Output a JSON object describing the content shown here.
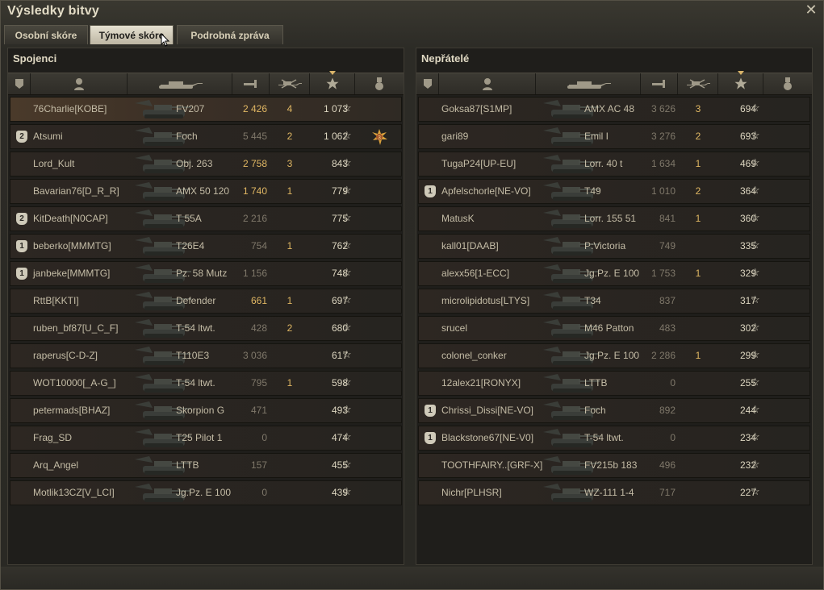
{
  "window": {
    "title": "Výsledky bitvy"
  },
  "tabs": [
    "Osobní skóre",
    "Týmové skóre",
    "Podrobná zpráva"
  ],
  "active_tab": 1,
  "left_team": {
    "title": "Spojenci",
    "players": [
      {
        "badge": "",
        "name": "76Charlie[KOBE]",
        "tank": "FV207",
        "dmg": "2 426",
        "dmg_hi": true,
        "frags": "4",
        "xp": "1 073",
        "me": true,
        "medal": false
      },
      {
        "badge": "2",
        "name": "Atsumi",
        "tank": "Foch",
        "dmg": "5 445",
        "dmg_hi": false,
        "frags": "2",
        "xp": "1 062",
        "me": false,
        "medal": true
      },
      {
        "badge": "",
        "name": "Lord_Kult",
        "tank": "Obj. 263",
        "dmg": "2 758",
        "dmg_hi": true,
        "frags": "3",
        "xp": "843",
        "me": false,
        "medal": false
      },
      {
        "badge": "",
        "name": "Bavarian76[D_R_R]",
        "tank": "AMX 50 120",
        "dmg": "1 740",
        "dmg_hi": true,
        "frags": "1",
        "xp": "779",
        "me": false,
        "medal": false
      },
      {
        "badge": "2",
        "name": "KitDeath[N0CAP]",
        "tank": "T 55A",
        "dmg": "2 216",
        "dmg_hi": false,
        "frags": "",
        "xp": "775",
        "me": false,
        "medal": false
      },
      {
        "badge": "1",
        "name": "beberko[MMMTG]",
        "tank": "T26E4",
        "dmg": "754",
        "dmg_hi": false,
        "frags": "1",
        "xp": "762",
        "me": false,
        "medal": false
      },
      {
        "badge": "1",
        "name": "janbeke[MMMTG]",
        "tank": "Pz. 58 Mutz",
        "dmg": "1 156",
        "dmg_hi": false,
        "frags": "",
        "xp": "748",
        "me": false,
        "medal": false
      },
      {
        "badge": "",
        "name": "RttB[KKTI]",
        "tank": "Defender",
        "dmg": "661",
        "dmg_hi": true,
        "frags": "1",
        "xp": "697",
        "me": false,
        "medal": false
      },
      {
        "badge": "",
        "name": "ruben_bf87[U_C_F]",
        "tank": "T-54 ltwt.",
        "dmg": "428",
        "dmg_hi": false,
        "frags": "2",
        "xp": "680",
        "me": false,
        "medal": false
      },
      {
        "badge": "",
        "name": "raperus[C-D-Z]",
        "tank": "T110E3",
        "dmg": "3 036",
        "dmg_hi": false,
        "frags": "",
        "xp": "617",
        "me": false,
        "medal": false
      },
      {
        "badge": "",
        "name": "WOT10000[_A-G_]",
        "tank": "T-54 ltwt.",
        "dmg": "795",
        "dmg_hi": false,
        "frags": "1",
        "xp": "598",
        "me": false,
        "medal": false
      },
      {
        "badge": "",
        "name": "petermads[BHAZ]",
        "tank": "Skorpion G",
        "dmg": "471",
        "dmg_hi": false,
        "frags": "",
        "xp": "493",
        "me": false,
        "medal": false
      },
      {
        "badge": "",
        "name": "Frag_SD",
        "tank": "T25 Pilot 1",
        "dmg": "0",
        "dmg_hi": false,
        "frags": "",
        "xp": "474",
        "me": false,
        "medal": false
      },
      {
        "badge": "",
        "name": "Arq_Angel",
        "tank": "LTTB",
        "dmg": "157",
        "dmg_hi": false,
        "frags": "",
        "xp": "455",
        "me": false,
        "medal": false
      },
      {
        "badge": "",
        "name": "Motlik13CZ[V_LCI]",
        "tank": "Jg.Pz. E 100",
        "dmg": "0",
        "dmg_hi": false,
        "frags": "",
        "xp": "439",
        "me": false,
        "medal": false
      }
    ]
  },
  "right_team": {
    "title": "Nepřátelé",
    "players": [
      {
        "badge": "",
        "name": "Goksa87[S1MP]",
        "tank": "AMX AC 48",
        "dmg": "3 626",
        "dmg_hi": false,
        "frags": "3",
        "xp": "694",
        "me": false,
        "medal": false
      },
      {
        "badge": "",
        "name": "gari89",
        "tank": "Emil I",
        "dmg": "3 276",
        "dmg_hi": false,
        "frags": "2",
        "xp": "693",
        "me": false,
        "medal": false
      },
      {
        "badge": "",
        "name": "TugaP24[UP-EU]",
        "tank": "Lorr. 40 t",
        "dmg": "1 634",
        "dmg_hi": false,
        "frags": "1",
        "xp": "469",
        "me": false,
        "medal": false
      },
      {
        "badge": "1",
        "name": "Apfelschorle[NE-VO]",
        "tank": "T49",
        "dmg": "1 010",
        "dmg_hi": false,
        "frags": "2",
        "xp": "364",
        "me": false,
        "medal": false
      },
      {
        "badge": "",
        "name": "MatusK",
        "tank": "Lorr. 155 51",
        "dmg": "841",
        "dmg_hi": false,
        "frags": "1",
        "xp": "360",
        "me": false,
        "medal": false
      },
      {
        "badge": "",
        "name": "kall01[DAAB]",
        "tank": "P:Victoria",
        "dmg": "749",
        "dmg_hi": false,
        "frags": "",
        "xp": "335",
        "me": false,
        "medal": false
      },
      {
        "badge": "",
        "name": "alexx56[1-ECC]",
        "tank": "Jg.Pz. E 100",
        "dmg": "1 753",
        "dmg_hi": false,
        "frags": "1",
        "xp": "329",
        "me": false,
        "medal": false
      },
      {
        "badge": "",
        "name": "microlipidotus[LTYS]",
        "tank": "T34",
        "dmg": "837",
        "dmg_hi": false,
        "frags": "",
        "xp": "317",
        "me": false,
        "medal": false
      },
      {
        "badge": "",
        "name": "srucel",
        "tank": "M46 Patton",
        "dmg": "483",
        "dmg_hi": false,
        "frags": "",
        "xp": "302",
        "me": false,
        "medal": false
      },
      {
        "badge": "",
        "name": "colonel_conker",
        "tank": "Jg.Pz. E 100",
        "dmg": "2 286",
        "dmg_hi": false,
        "frags": "1",
        "xp": "299",
        "me": false,
        "medal": false
      },
      {
        "badge": "",
        "name": "12alex21[RONYX]",
        "tank": "LTTB",
        "dmg": "0",
        "dmg_hi": false,
        "frags": "",
        "xp": "255",
        "me": false,
        "medal": false
      },
      {
        "badge": "1",
        "name": "Chrissi_Dissi[NE-VO]",
        "tank": "Foch",
        "dmg": "892",
        "dmg_hi": false,
        "frags": "",
        "xp": "244",
        "me": false,
        "medal": false
      },
      {
        "badge": "1",
        "name": "Blackstone67[NE-V0]",
        "tank": "T-54 ltwt.",
        "dmg": "0",
        "dmg_hi": false,
        "frags": "",
        "xp": "234",
        "me": false,
        "medal": false
      },
      {
        "badge": "",
        "name": "TOOTHFAIRY..[GRF-X]",
        "tank": "FV215b 183",
        "dmg": "496",
        "dmg_hi": false,
        "frags": "",
        "xp": "232",
        "me": false,
        "medal": false
      },
      {
        "badge": "",
        "name": "Nichr[PLHSR]",
        "tank": "WZ-111 1-4",
        "dmg": "717",
        "dmg_hi": false,
        "frags": "",
        "xp": "227",
        "me": false,
        "medal": false
      }
    ]
  },
  "columns": [
    "squad-icon",
    "player-icon",
    "tank-icon",
    "damage-icon",
    "frags-icon",
    "xp-star-icon",
    "medal-icon"
  ],
  "colors": {
    "accent_gold": "#e0b763",
    "dim": "#7f786a",
    "text": "#c4bca6"
  }
}
